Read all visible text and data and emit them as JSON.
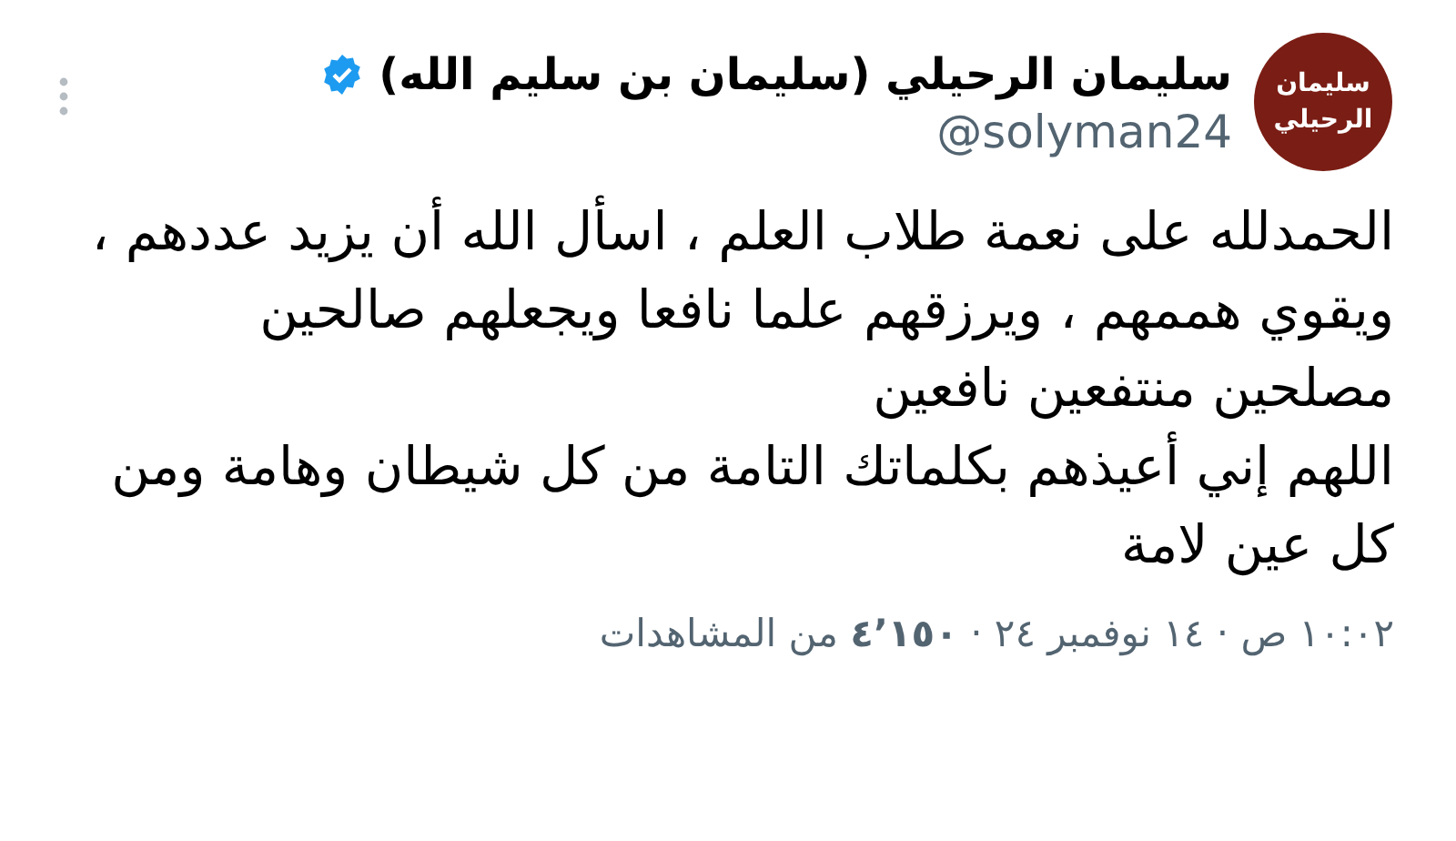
{
  "author": {
    "avatar_text": "سليمان الرحيلي",
    "name": "سليمان الرحيلي (سليمان بن سليم الله)",
    "verified": true,
    "handle": "@solyman24"
  },
  "paragraphs": [
    "الحمدلله على نعمة طلاب العلم ، اسأل الله أن يزيد عددهم ، ويقوي هممهم ، ويرزقهم علما نافعا ويجعلهم صالحين مصلحين منتفعين نافعين",
    "اللهم إني أعيذهم بكلماتك التامة من كل شيطان وهامة ومن كل عين لامة"
  ],
  "meta": "١٠:٠٢ ص · ١٤ نوفمبر ٢٤ · **٤٬١٥٠** من المشاهدات"
}
